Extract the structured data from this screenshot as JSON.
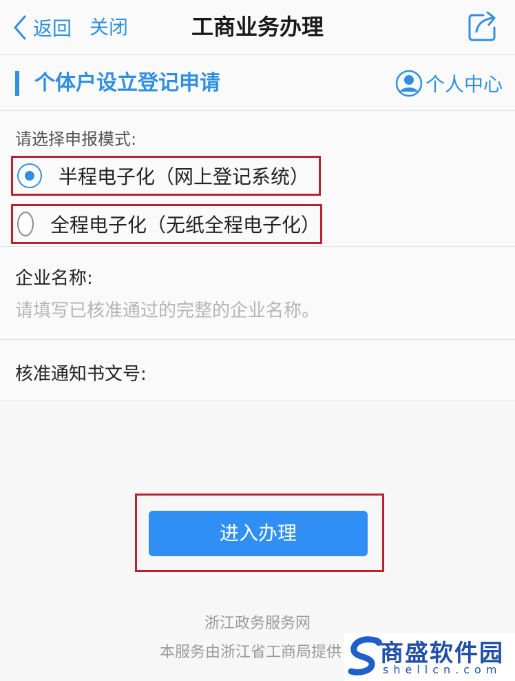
{
  "nav": {
    "back_label": "返回",
    "close_label": "关闭",
    "title": "工商业务办理"
  },
  "section": {
    "title": "个体户设立登记申请",
    "personal_center": "个人中心"
  },
  "mode": {
    "label": "请选择申报模式:",
    "options": [
      {
        "label": "半程电子化（网上登记系统）",
        "checked": true
      },
      {
        "label": "全程电子化（无纸全程电子化）",
        "checked": false
      }
    ]
  },
  "fields": {
    "company_name": {
      "label": "企业名称:",
      "placeholder": "请填写已核准通过的完整的企业名称。",
      "value": ""
    },
    "approval_number": {
      "label": "核准通知书文号:",
      "value": ""
    }
  },
  "submit": {
    "label": "进入办理"
  },
  "footer": {
    "line1": "浙江政务服务网",
    "line2": "本服务由浙江省工商局提供"
  },
  "watermark": {
    "name": "商盛软件园",
    "domain": "shellcn.com"
  },
  "colors": {
    "accent": "#2f8fe0",
    "button": "#2f8ff5",
    "highlight": "#b8232f"
  },
  "icons": {
    "back": "chevron-left-icon",
    "share": "share-icon",
    "user": "user-circle-icon"
  }
}
